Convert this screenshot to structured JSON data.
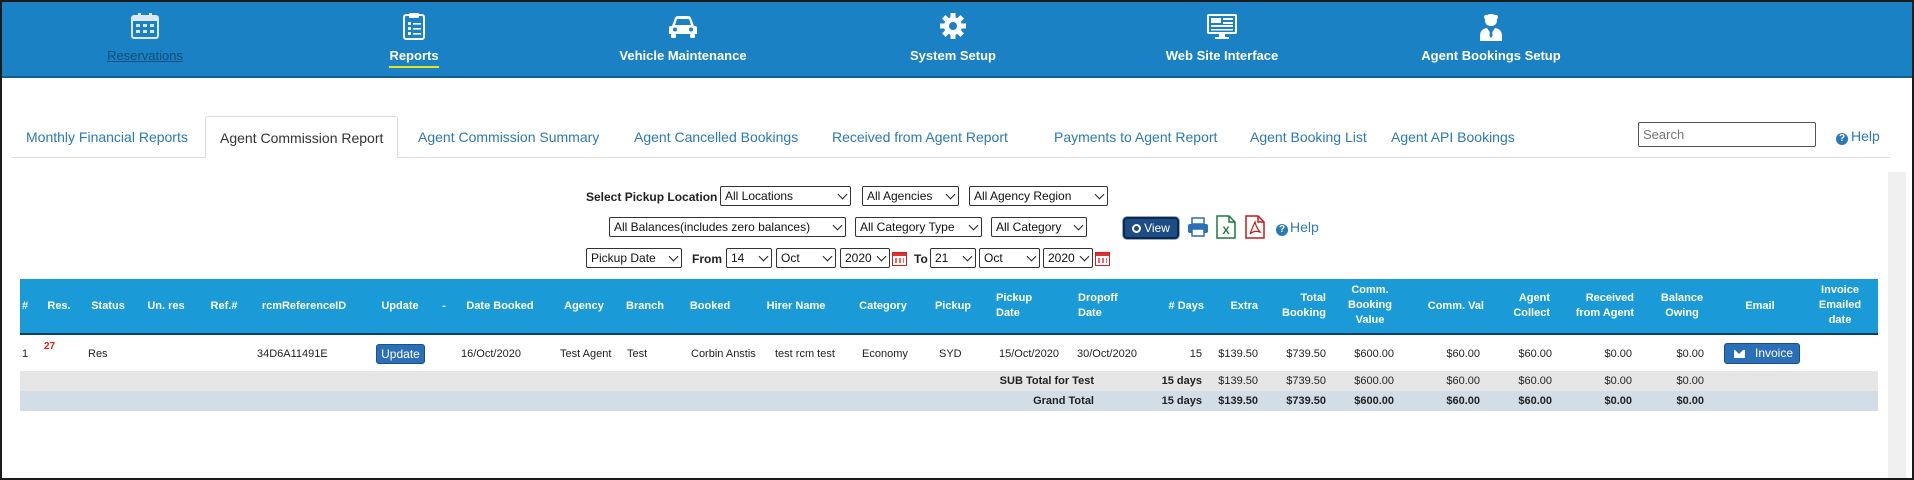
{
  "nav": [
    {
      "label": "Reservations",
      "icon": "calendar-icon",
      "state": "dim"
    },
    {
      "label": "Reports",
      "icon": "clipboard-list-icon",
      "state": "active"
    },
    {
      "label": "Vehicle Maintenance",
      "icon": "car-icon",
      "state": "normal"
    },
    {
      "label": "System Setup",
      "icon": "gear-icon",
      "state": "normal"
    },
    {
      "label": "Web Site Interface",
      "icon": "monitor-icon",
      "state": "normal"
    },
    {
      "label": "Agent Bookings Setup",
      "icon": "agent-icon",
      "state": "normal"
    }
  ],
  "tabs": [
    {
      "label": "Monthly Financial Reports"
    },
    {
      "label": "Agent Commission Report",
      "active": true
    },
    {
      "label": "Agent Commission Summary"
    },
    {
      "label": "Agent Cancelled Bookings"
    },
    {
      "label": "Received from Agent Report"
    },
    {
      "label": "Payments to Agent Report"
    },
    {
      "label": "Agent Booking List"
    },
    {
      "label": "Agent API Bookings"
    }
  ],
  "search": {
    "placeholder": "Search"
  },
  "help": "Help",
  "filters": {
    "pickup_location_label": "Select Pickup Location",
    "pickup_location": "All Locations",
    "agencies": "All Agencies",
    "agency_region": "All Agency Region",
    "balances": "All Balances(includes zero balances)",
    "category_type": "All Category Type",
    "category": "All Category",
    "view_label": "View",
    "help_label": "Help",
    "date_type": "Pickup Date",
    "from_label": "From",
    "from_day": "14",
    "from_month": "Oct",
    "from_year": "2020",
    "to_label": "To",
    "to_day": "21",
    "to_month": "Oct",
    "to_year": "2020"
  },
  "table": {
    "headers": {
      "num": "#",
      "res": "Res.",
      "status": "Status",
      "unres": "Un. res",
      "ref": "Ref.#",
      "rcmref": "rcmReferenceID",
      "update": "Update",
      "dash": "-",
      "datebooked": "Date Booked",
      "agency": "Agency",
      "branch": "Branch",
      "booked": "Booked",
      "hirer": "Hirer Name",
      "category": "Category",
      "pickup": "Pickup",
      "pickupdate": "Pickup Date",
      "dropoffdate": "Dropoff Date",
      "days": "# Days",
      "extra": "Extra",
      "totalbooking": "Total Booking",
      "commbooking": "Comm. Booking Value",
      "commval": "Comm. Val",
      "agentcollect": "Agent Collect",
      "received": "Received from Agent",
      "balance": "Balance Owing",
      "email": "Email",
      "invoiceemailed": "Invoice Emailed date"
    },
    "row": {
      "num": "1",
      "res": "27",
      "status": "Res",
      "rcmref": "34D6A11491E",
      "update_label": "Update",
      "datebooked": "16/Oct/2020",
      "agency": "Test Agent",
      "branch": "Test",
      "booked": "Corbin Anstis",
      "hirer": "test rcm test",
      "category": "Economy",
      "pickup": "SYD",
      "pickupdate": "15/Oct/2020",
      "dropoffdate": "30/Oct/2020",
      "days": "15",
      "extra": "$139.50",
      "totalbooking": "$739.50",
      "commbooking": "$600.00",
      "commval": "$60.00",
      "agentcollect": "$60.00",
      "received": "$0.00",
      "balance": "$0.00",
      "invoice_label": "Invoice"
    },
    "subtotal": {
      "label": "SUB Total for Test",
      "days": "15 days",
      "extra": "$139.50",
      "totalbooking": "$739.50",
      "commbooking": "$600.00",
      "commval": "$60.00",
      "agentcollect": "$60.00",
      "received": "$0.00",
      "balance": "$0.00"
    },
    "grandtotal": {
      "label": "Grand Total",
      "days": "15 days",
      "extra": "$139.50",
      "totalbooking": "$739.50",
      "commbooking": "$600.00",
      "commval": "$60.00",
      "agentcollect": "$60.00",
      "received": "$0.00",
      "balance": "$0.00"
    }
  },
  "colors": {
    "nav_bg": "#1a82c4",
    "header_bg": "#1a9ad6",
    "button": "#2a6fb7",
    "subtotal_bg": "#e6e6e6",
    "grandtotal_bg": "#d3dde6"
  }
}
